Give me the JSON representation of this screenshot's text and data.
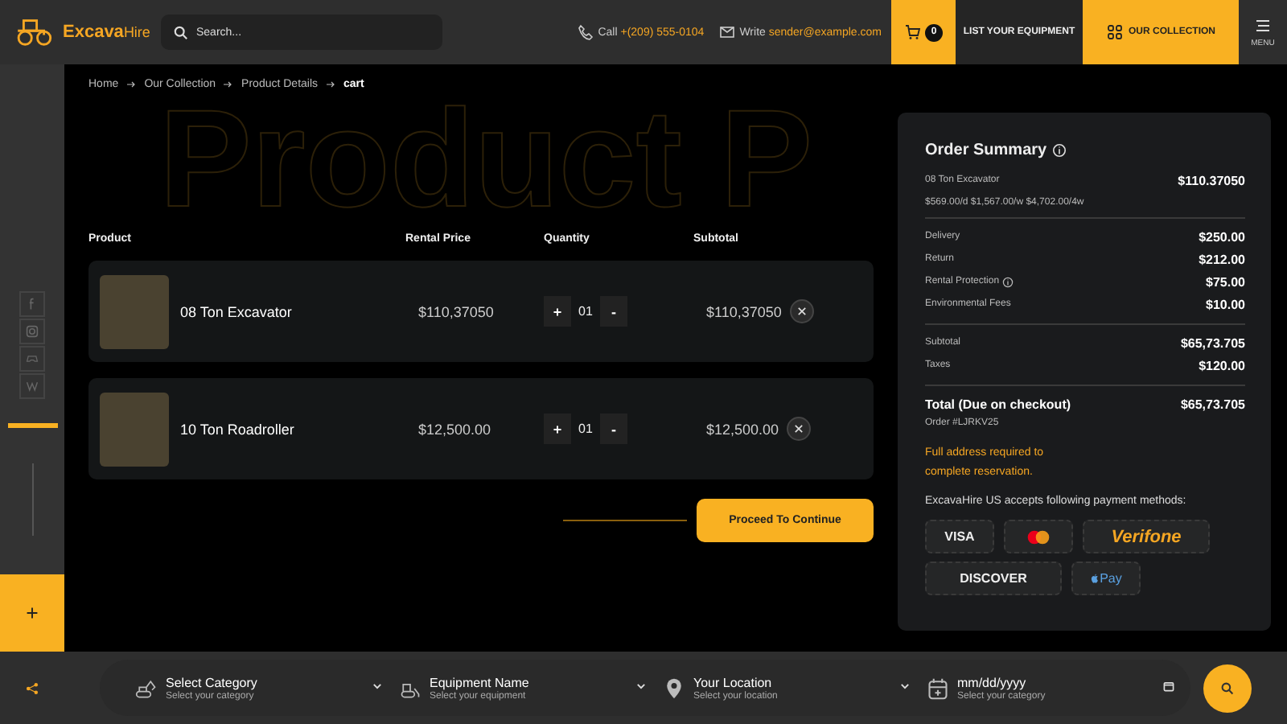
{
  "header": {
    "brand_1": "Excava",
    "brand_2": "Hire",
    "search": {
      "placeholder": "Search..."
    },
    "call_label": "Call",
    "phone": "+(209) 555-0104",
    "write_label": "Write",
    "email": "sender@example.com",
    "cart_count": "0",
    "nav": [
      {
        "label": "LIST YOUR EQUIPMENT",
        "selected": false
      },
      {
        "label": "OUR COLLECTION",
        "selected": true
      }
    ],
    "menu_label": "MENU"
  },
  "breadcrumb": [
    "Home",
    "Our Collection",
    "Product Details",
    "cart"
  ],
  "hero_text": "Product P",
  "table": {
    "columns": [
      "Product",
      "Rental Price",
      "Quantity",
      "Subtotal"
    ],
    "plus": "+",
    "minus": "-",
    "rows": [
      {
        "name": "08 Ton Excavator",
        "price": "$110,37050",
        "quantity": "01",
        "subtotal": "$110,37050"
      },
      {
        "name": "10 Ton Roadroller",
        "price": "$12,500.00",
        "quantity": "01",
        "subtotal": "$12,500.00"
      }
    ]
  },
  "proceed_button": "Proceed To Continue",
  "order_summary": {
    "title": "Order Summary",
    "item": {
      "name": "08 Ton Excavator",
      "price": "$110.37050"
    },
    "rates": "$569.00/d $1,567.00/w $4,702.00/4w",
    "fees": [
      {
        "label": "Delivery",
        "value": "$250.00",
        "info": false
      },
      {
        "label": "Return",
        "value": "$212.00",
        "info": false
      },
      {
        "label": "Rental Protection",
        "value": "$75.00",
        "info": true
      },
      {
        "label": "Environmental Fees",
        "value": "$10.00",
        "info": false
      }
    ],
    "subtotals": [
      {
        "label": "Subtotal",
        "value": "$65,73.705"
      },
      {
        "label": "Taxes",
        "value": "$120.00"
      }
    ],
    "total": {
      "label": "Total (Due on checkout)",
      "value": "$65,73.705"
    },
    "order_number": "Order #LJRKV25",
    "warning": "Full address required to complete reservation.",
    "payment_note": "ExcavaHire US accepts following payment methods:",
    "payment_methods": [
      {
        "kind": "visa",
        "label": "VISA"
      },
      {
        "kind": "mastercard"
      },
      {
        "kind": "verifone",
        "label": "Verifone"
      },
      {
        "kind": "discover",
        "label": "DISCOVER"
      },
      {
        "kind": "applepay",
        "label": "Pay"
      }
    ]
  },
  "search_bar": [
    {
      "kind": "category",
      "label": "Select Category",
      "hint": "Select your category"
    },
    {
      "kind": "equipment",
      "label": "Equipment Name",
      "hint": "Select your equipment"
    },
    {
      "kind": "location",
      "label": "Your Location",
      "hint": "Select your location"
    },
    {
      "kind": "date",
      "label": "mm/dd/yyyy",
      "hint": "Select your category"
    }
  ]
}
